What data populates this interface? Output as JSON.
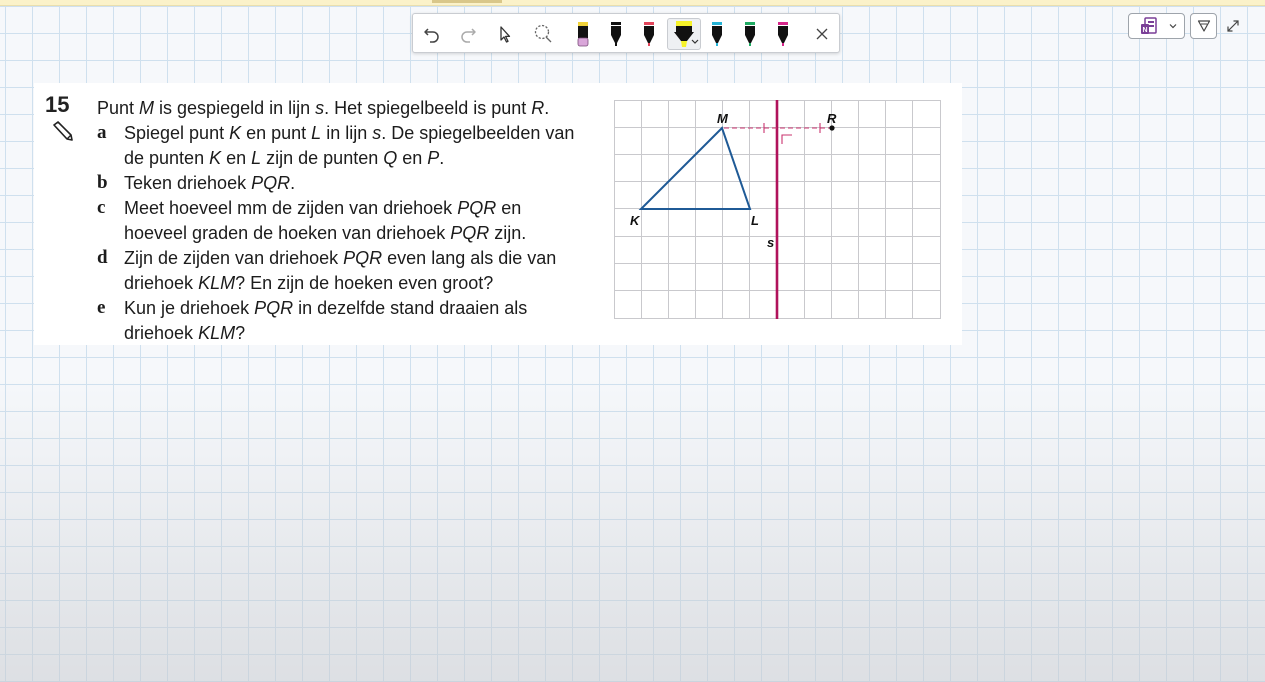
{
  "toolbar": {
    "undo_icon": "undo-icon",
    "redo_icon": "redo-icon",
    "select_icon": "pointer-icon",
    "lasso_icon": "lasso-icon",
    "pens": [
      {
        "name": "eraser",
        "color": "#d9a6d9"
      },
      {
        "name": "black-pen",
        "color": "#111111"
      },
      {
        "name": "red-pen",
        "color": "#e2455a"
      },
      {
        "name": "yellow-highlighter",
        "color": "#f6f22a",
        "selected": true
      },
      {
        "name": "blue-pen",
        "color": "#25b3d6"
      },
      {
        "name": "green-pen",
        "color": "#1faa62"
      },
      {
        "name": "pink-pen",
        "color": "#d6268a"
      }
    ],
    "close_icon": "close-icon"
  },
  "right_tools": {
    "onenote_icon": "onenote-icon",
    "dropdown_icon": "chevron-down-icon",
    "filter_icon": "filter-icon",
    "expand_icon": "expand-icon"
  },
  "exercise": {
    "number": "15",
    "intro_parts": [
      "Punt ",
      "M",
      " is gespiegeld in lijn ",
      "s",
      ". Het spiegelbeeld is punt ",
      "R",
      "."
    ],
    "a": {
      "letter": "a",
      "line1": [
        "Spiegel punt ",
        "K",
        " en punt ",
        "L",
        " in lijn ",
        "s",
        ". De spiegelbeelden van"
      ],
      "line2": [
        "de punten ",
        "K",
        " en ",
        "L",
        " zijn de punten ",
        "Q",
        " en ",
        "P",
        "."
      ]
    },
    "b": {
      "letter": "b",
      "line1": [
        "Teken driehoek ",
        "PQR",
        "."
      ]
    },
    "c": {
      "letter": "c",
      "line1": [
        "Meet hoeveel mm de zijden van driehoek ",
        "PQR",
        " en"
      ],
      "line2": [
        "hoeveel graden de hoeken van driehoek ",
        "PQR",
        " zijn."
      ]
    },
    "d": {
      "letter": "d",
      "line1": [
        "Zijn de zijden van driehoek ",
        "PQR",
        " even lang als die van"
      ],
      "line2": [
        "driehoek ",
        "KLM",
        "? En zijn de hoeken even groot?"
      ]
    },
    "e": {
      "letter": "e",
      "line1": [
        "Kun je driehoek ",
        "PQR",
        " in dezelfde stand draaien als"
      ],
      "line2": [
        "driehoek ",
        "KLM",
        "?"
      ]
    }
  },
  "figure": {
    "labels": {
      "M": "M",
      "R": "R",
      "K": "K",
      "L": "L",
      "s": "s"
    },
    "triangle_color": "#1f5a96",
    "mirror_color": "#b0125b"
  }
}
